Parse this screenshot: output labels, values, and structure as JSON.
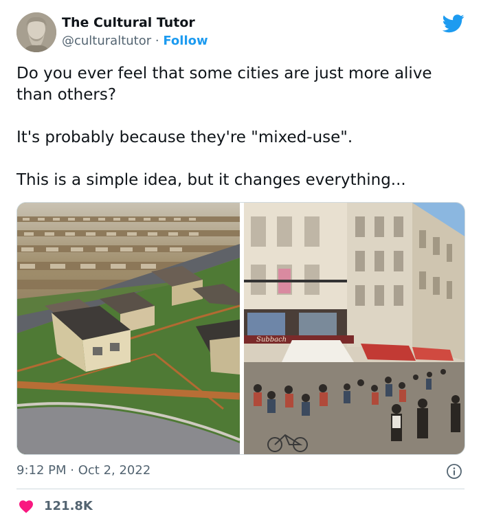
{
  "author": {
    "name": "The Cultural Tutor",
    "handle": "@culturaltutor",
    "separator": "·",
    "follow_label": "Follow"
  },
  "tweet": {
    "paragraphs": [
      "Do you ever feel that some cities are just more alive than others?",
      "It's probably because they're \"mixed-use\".",
      "This is a simple idea, but it changes everything..."
    ]
  },
  "media": {
    "left_image": "suburb-aerial-photo",
    "right_image": "paris-street-photo",
    "shop_sign": "Subbach"
  },
  "meta": {
    "time": "9:12 PM",
    "separator": "·",
    "date": "Oct 2, 2022"
  },
  "engagement": {
    "likes": "121.8K"
  },
  "colors": {
    "accent": "#1d9bf0",
    "like": "#f91880",
    "secondary_text": "#536471"
  },
  "icons": {
    "brand": "twitter-bird-icon",
    "info": "info-icon",
    "like": "heart-icon"
  }
}
